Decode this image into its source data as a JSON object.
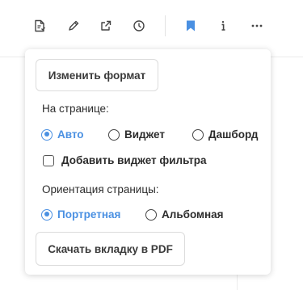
{
  "toolbar": {
    "icons": [
      "document-icon",
      "pencil-icon",
      "external-link-icon",
      "clock-icon",
      "bookmark-icon",
      "info-icon",
      "more-icon"
    ],
    "accent_color": "#4a90e2"
  },
  "popover": {
    "change_format_label": "Изменить формат",
    "on_page_label": "На странице:",
    "layout_options": [
      {
        "label": "Авто",
        "selected": true
      },
      {
        "label": "Виджет",
        "selected": false
      },
      {
        "label": "Дашборд",
        "selected": false
      }
    ],
    "add_filter_widget_label": "Добавить виджет фильтра",
    "add_filter_widget_checked": false,
    "orientation_label": "Ориентация страницы:",
    "orientation_options": [
      {
        "label": "Портретная",
        "selected": true
      },
      {
        "label": "Альбомная",
        "selected": false
      }
    ],
    "download_label": "Скачать вкладку в PDF"
  }
}
